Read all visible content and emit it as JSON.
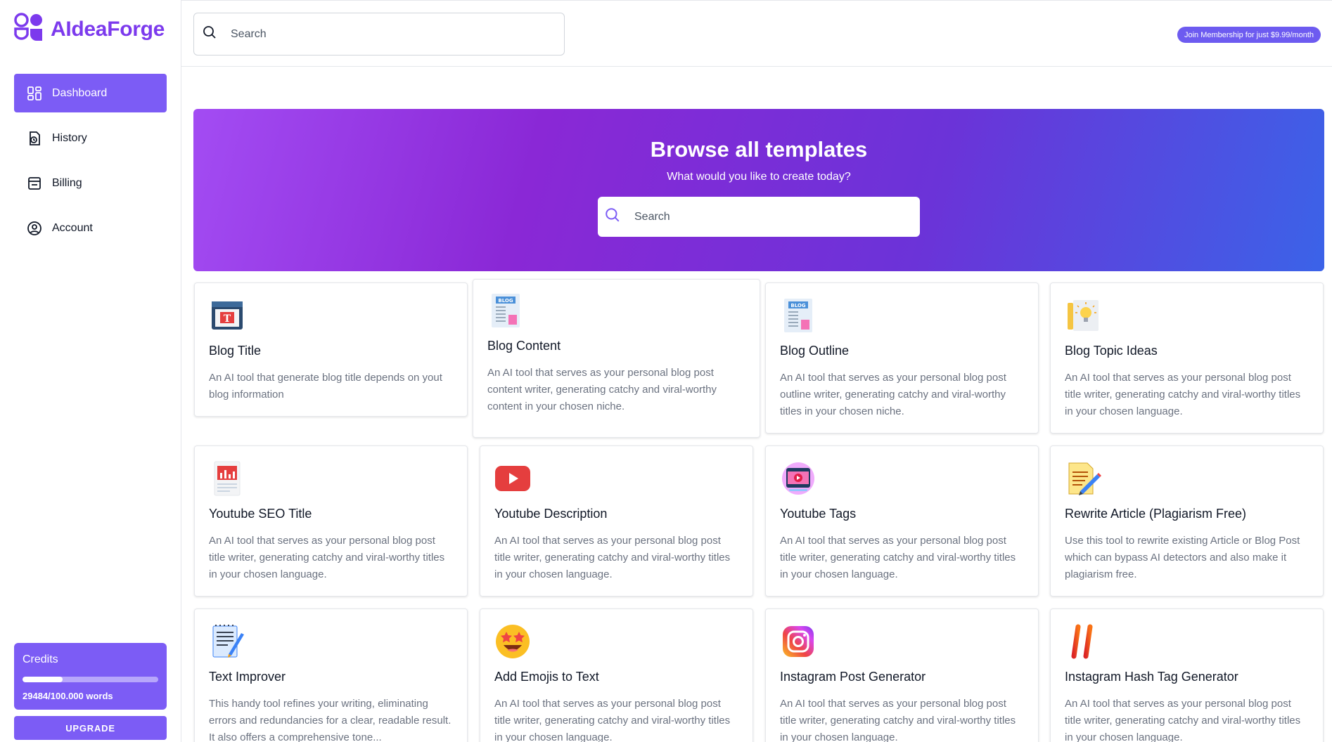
{
  "app": {
    "name": "AIdeaForge"
  },
  "sidebar": {
    "items": [
      {
        "label": "Dashboard",
        "icon": "dashboard-icon",
        "active": true
      },
      {
        "label": "History",
        "icon": "history-icon"
      },
      {
        "label": "Billing",
        "icon": "billing-icon"
      },
      {
        "label": "Account",
        "icon": "account-icon"
      }
    ],
    "credits": {
      "title": "Credits",
      "used": 29484,
      "total": 100000,
      "words_label": "29484/100.000 words"
    },
    "upgrade_label": "UPGRADE"
  },
  "header": {
    "search_placeholder": "Search",
    "membership_label": "Join Membership for just $9.99/month"
  },
  "hero": {
    "title": "Browse all templates",
    "subtitle": "What would you like to create today?",
    "search_placeholder": "Search"
  },
  "colors": {
    "accent": "#7c5cf5",
    "brand": "#7c3aed"
  },
  "templates": [
    {
      "title": "Blog Title",
      "desc": "An AI tool that generate blog title depends on yout blog information",
      "icon": "blog-title-icon"
    },
    {
      "title": "Blog Content",
      "desc": "An AI tool that serves as your personal blog post content writer, generating catchy and viral-worthy content in your chosen niche.",
      "icon": "blog-document-icon"
    },
    {
      "title": "Blog Outline",
      "desc": "An AI tool that serves as your personal blog post outline writer, generating catchy and viral-worthy titles in your chosen niche.",
      "icon": "blog-document-icon"
    },
    {
      "title": "Blog Topic Ideas",
      "desc": "An AI tool that serves as your personal blog post title writer, generating catchy and viral-worthy titles in your chosen language.",
      "icon": "lightbulb-icon"
    },
    {
      "title": "Youtube SEO Title",
      "desc": "An AI tool that serves as your personal blog post title writer, generating catchy and viral-worthy titles in your chosen language.",
      "icon": "seo-chart-icon"
    },
    {
      "title": "Youtube Description",
      "desc": "An AI tool that serves as your personal blog post title writer, generating catchy and viral-worthy titles in your chosen language.",
      "icon": "youtube-icon"
    },
    {
      "title": "Youtube Tags",
      "desc": "An AI tool that serves as your personal blog post title writer, generating catchy and viral-worthy titles in your chosen language.",
      "icon": "video-player-icon"
    },
    {
      "title": "Rewrite Article (Plagiarism Free)",
      "desc": "Use this tool to rewrite existing Article or Blog Post which can bypass AI detectors and also make it plagiarism free.",
      "icon": "pencil-paper-icon"
    },
    {
      "title": "Text Improver",
      "desc": "This handy tool refines your writing, eliminating errors and redundancies for a clear, readable result. It also offers a comprehensive tone...",
      "icon": "notepad-icon"
    },
    {
      "title": "Add Emojis to Text",
      "desc": "An AI tool that serves as your personal blog post title writer, generating catchy and viral-worthy titles in your chosen language.",
      "icon": "star-eyes-emoji-icon"
    },
    {
      "title": "Instagram Post Generator",
      "desc": "An AI tool that serves as your personal blog post title writer, generating catchy and viral-worthy titles in your chosen language.",
      "icon": "instagram-icon"
    },
    {
      "title": "Instagram Hash Tag Generator",
      "desc": "An AI tool that serves as your personal blog post title writer, generating catchy and viral-worthy titles in your chosen language.",
      "icon": "hashtag-icon"
    }
  ]
}
